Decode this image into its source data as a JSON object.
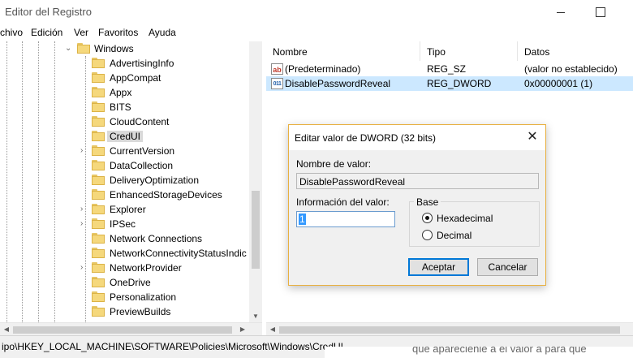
{
  "window": {
    "title": "Editor del Registro"
  },
  "menu": [
    "chivo",
    "Edición",
    "Ver",
    "Favoritos",
    "Ayuda"
  ],
  "tree": {
    "parent": "Windows",
    "children": [
      {
        "label": "AdvertisingInfo",
        "expandable": false
      },
      {
        "label": "AppCompat",
        "expandable": false
      },
      {
        "label": "Appx",
        "expandable": false
      },
      {
        "label": "BITS",
        "expandable": false
      },
      {
        "label": "CloudContent",
        "expandable": false
      },
      {
        "label": "CredUI",
        "expandable": false,
        "selected": true
      },
      {
        "label": "CurrentVersion",
        "expandable": true
      },
      {
        "label": "DataCollection",
        "expandable": false
      },
      {
        "label": "DeliveryOptimization",
        "expandable": false
      },
      {
        "label": "EnhancedStorageDevices",
        "expandable": false
      },
      {
        "label": "Explorer",
        "expandable": true
      },
      {
        "label": "IPSec",
        "expandable": true
      },
      {
        "label": "Network Connections",
        "expandable": false
      },
      {
        "label": "NetworkConnectivityStatusIndic",
        "expandable": false
      },
      {
        "label": "NetworkProvider",
        "expandable": true
      },
      {
        "label": "OneDrive",
        "expandable": false
      },
      {
        "label": "Personalization",
        "expandable": false
      },
      {
        "label": "PreviewBuilds",
        "expandable": false
      }
    ]
  },
  "list": {
    "columns": [
      "Nombre",
      "Tipo",
      "Datos"
    ],
    "rows": [
      {
        "icon": "string-value-icon",
        "icon_glyph": "ab",
        "name": "(Predeterminado)",
        "type": "REG_SZ",
        "data": "(valor no establecido)"
      },
      {
        "icon": "binary-value-icon",
        "icon_glyph": "011",
        "name": "DisablePasswordReveal",
        "type": "REG_DWORD",
        "data": "0x00000001 (1)",
        "selected": true
      }
    ]
  },
  "status": {
    "path": "ipo\\HKEY_LOCAL_MACHINE\\SOFTWARE\\Policies\\Microsoft\\Windows\\CredUI"
  },
  "background_text": "que aparecienle a el valor a para que",
  "dialog": {
    "title": "Editar valor de DWORD (32 bits)",
    "close_glyph": "✕",
    "name_label": "Nombre de valor:",
    "name_value": "DisablePasswordReveal",
    "value_label": "Información del valor:",
    "value": "1",
    "base_label": "Base",
    "base_options": [
      {
        "label": "Hexadecimal",
        "checked": true
      },
      {
        "label": "Decimal",
        "checked": false
      }
    ],
    "ok_label": "Aceptar",
    "cancel_label": "Cancelar"
  },
  "colors": {
    "selection_list": "#cce8ff",
    "selection_tree": "#d9d9d9",
    "dialog_border": "#e8b040",
    "default_button_border": "#0078d7",
    "input_selection": "#3399ff"
  }
}
